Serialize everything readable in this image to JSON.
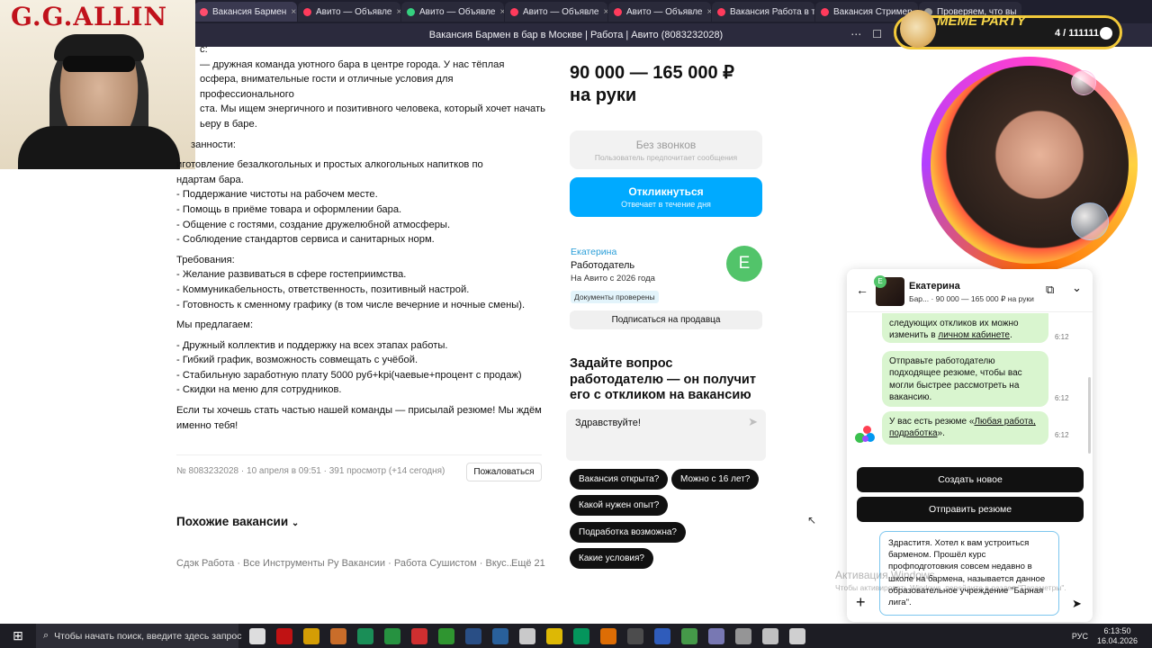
{
  "browser": {
    "tabs": [
      {
        "label": "Вакансия Бармен",
        "color": "#ff4d6d",
        "active": true
      },
      {
        "label": "Авито — Объявле",
        "color": "#ff3b5c"
      },
      {
        "label": "Авито — Объявле",
        "color": "#35d07f"
      },
      {
        "label": "Авито — Объявле",
        "color": "#ff3b5c"
      },
      {
        "label": "Авито — Объявле",
        "color": "#ff3b5c"
      },
      {
        "label": "Вакансия Работа в т",
        "color": "#ff3b5c"
      },
      {
        "label": "Вакансия Стример,",
        "color": "#ff3b5c"
      },
      {
        "label": "Проверяем, что вы",
        "color": "#999999"
      }
    ],
    "page_title": "Вакансия Бармен в бар в Москве | Работа | Авито (8083232028)"
  },
  "overlay": {
    "gg_allin": "G.G.ALLIN",
    "meme_party": "MEME PARTY",
    "counter": "4 / 111111"
  },
  "description": {
    "intro_lines": [
      "с:",
      "— дружная команда уютного бара в центре города. У нас тёплая",
      "осфера, внимательные гости и отличные условия для профессионального",
      "ста. Мы ищем энергичного и позитивного человека, который хочет начать",
      "ьеру в баре."
    ],
    "duties_heading": "занности:",
    "duties": [
      "иготовление безалкогольных и простых алкогольных напитков по",
      "ндартам бара.",
      "- Поддержание чистоты на рабочем месте.",
      "- Помощь в приёме товара и оформлении бара.",
      "- Общение с гостями, создание дружелюбной атмосферы.",
      "- Соблюдение стандартов сервиса и санитарных норм."
    ],
    "requirements_heading": "Требования:",
    "requirements": [
      "- Желание развиваться в сфере гостеприимства.",
      "- Коммуникабельность, ответственность, позитивный настрой.",
      "- Готовность к сменному графику (в том числе вечерние и ночные смены)."
    ],
    "offer_heading": "Мы предлагаем:",
    "offer": [
      "- Дружный коллектив и поддержку на всех этапах работы.",
      "- Гибкий график, возможность совмещать с учёбой.",
      "- Стабильную заработную плату 5000 руб+kpi(чаевые+процент с продаж)",
      "- Скидки на меню для сотрудников."
    ],
    "closing": [
      "Если ты хочешь стать частью нашей команды — присылай резюме! Мы ждём",
      "именно тебя!"
    ]
  },
  "meta": {
    "line": "№ 8083232028 · 10 апреля в 09:51 · 391 просмотр (+14 сегодня)",
    "complain": "Пожаловаться",
    "similar": "Похожие вакансии",
    "links": "Сдэк Работа · Все Инструменты Ру Вакансии · Работа Сушистом · Вкус...",
    "more": "Ещё 21"
  },
  "sidebar": {
    "salary": [
      "90 000 — 165 000 ₽",
      "на руки"
    ],
    "no_calls": "Без звонков",
    "no_calls_sub": "Пользователь предпочитает сообщения",
    "respond": "Откликнуться",
    "respond_sub": "Отвечает в течение дня",
    "seller_name": "Екатерина",
    "seller_role": "Работодатель",
    "seller_since": "На Авито с 2026 года",
    "docs": "Документы проверены",
    "avatar_letter": "Е",
    "subscribe": "Подписаться на продавца",
    "ask_heading": [
      "Задайте вопрос",
      "работодателю — он получит",
      "его с откликом на вакансию"
    ],
    "question_value": "Здравствуйте!",
    "chips": [
      "Вакансия открыта?",
      "Можно с 16 лет?",
      "Какой нужен опыт?",
      "Подработка возможна?",
      "Какие условия?"
    ]
  },
  "chat": {
    "name": "Екатерина",
    "avatar_letter": "Е",
    "subtitle": "Бар... · 90 000 — 165 000 ₽ на руки",
    "msg1": [
      "следующих откликов их можно",
      "изменить в личном кабинете."
    ],
    "msg1_link": "личном кабинете",
    "msg2": [
      "Отправьте работодателю",
      "подходящее резюме, чтобы вас",
      "могли быстрее рассмотреть на",
      "вакансию."
    ],
    "msg3_a": "У вас есть резюме «",
    "msg3_link": "Любая работа, подработка",
    "msg3_b": "».",
    "time": "6:12",
    "create_new": "Создать новое",
    "send_resume": "Отправить резюме",
    "draft": "Здраститя. Хотел к вам устроиться бармeном. Прошёл курс профподготовкия совсем недавно в школе на бармена, называется данное образовательное учреждение \"Барная лига\"."
  },
  "watermark": {
    "title": "Активация Windows",
    "sub": "Чтобы активировать Windows, перейдите в раздел \"Параметры\"."
  },
  "taskbar": {
    "search": "Чтобы начать поиск, введите здесь запрос",
    "lang": "РУС",
    "time": "6:13:50",
    "date": "16.04.2026"
  }
}
